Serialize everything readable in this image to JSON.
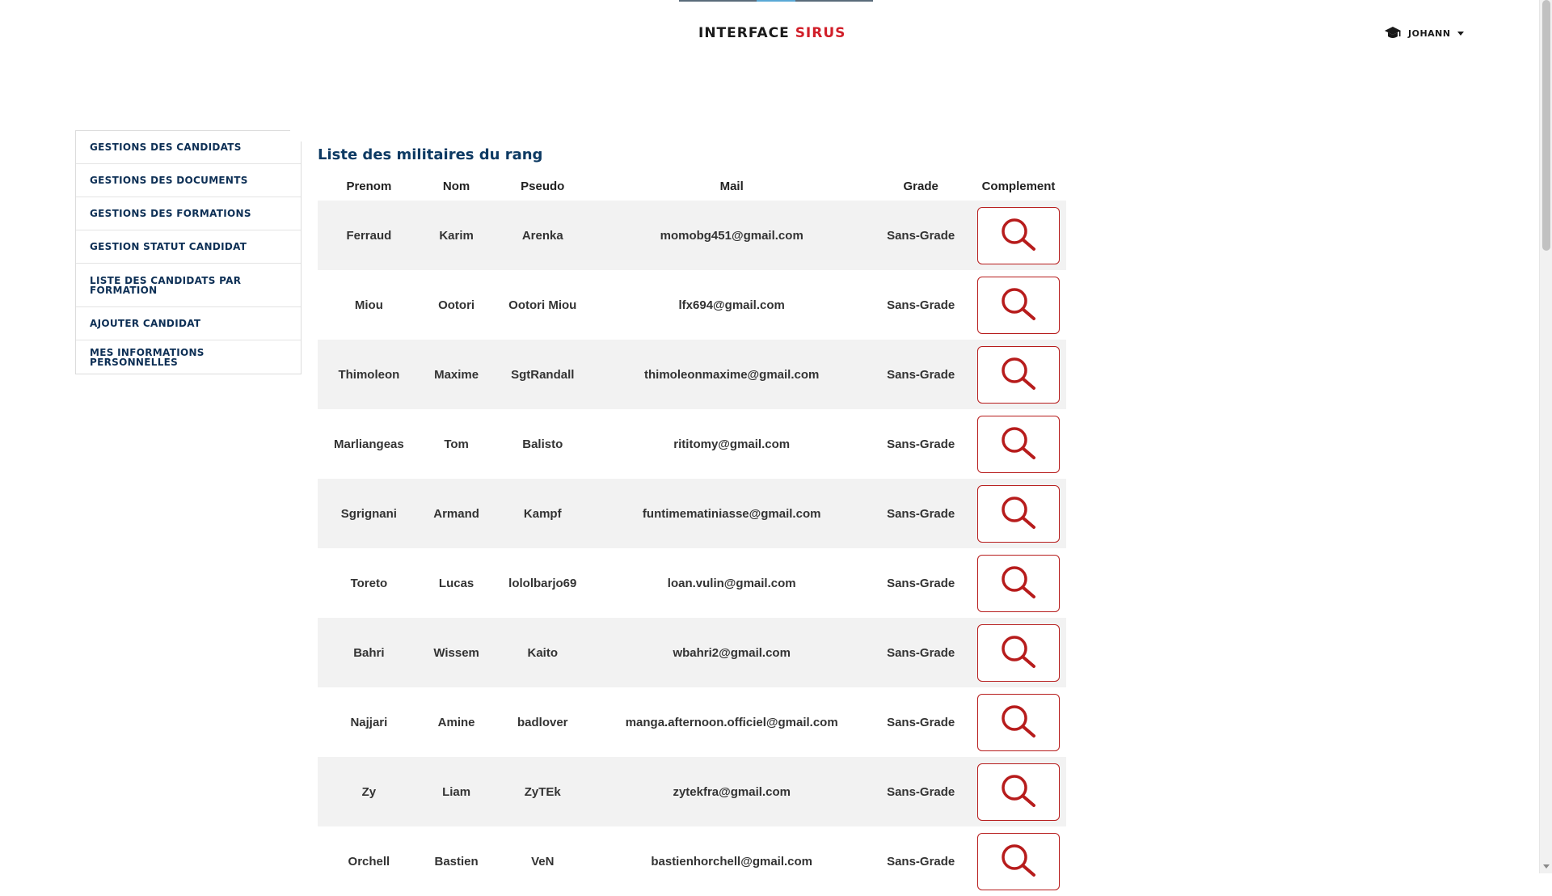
{
  "header": {
    "brand_main": "INTERFACE",
    "brand_accent": "SIRUS",
    "user_name": "JOHANN",
    "user_icon": "graduation-cap-icon"
  },
  "sidebar": {
    "items": [
      {
        "label": "GESTIONS DES CANDIDATS"
      },
      {
        "label": "GESTIONS DES DOCUMENTS"
      },
      {
        "label": "GESTIONS DES FORMATIONS"
      },
      {
        "label": "GESTION STATUT CANDIDAT"
      },
      {
        "label": "LISTE DES CANDIDATS PAR FORMATION"
      },
      {
        "label": "AJOUTER CANDIDAT"
      },
      {
        "label": "MES INFORMATIONS PERSONNELLES"
      }
    ]
  },
  "main": {
    "title": "Liste des militaires du rang",
    "columns": [
      "Prenom",
      "Nom",
      "Pseudo",
      "Mail",
      "Grade",
      "Complement"
    ],
    "rows": [
      {
        "prenom": "Ferraud",
        "nom": "Karim",
        "pseudo": "Arenka",
        "mail": "momobg451@gmail.com",
        "grade": "Sans-Grade"
      },
      {
        "prenom": "Miou",
        "nom": "Ootori",
        "pseudo": "Ootori Miou",
        "mail": "lfx694@gmail.com",
        "grade": "Sans-Grade"
      },
      {
        "prenom": "Thimoleon",
        "nom": "Maxime",
        "pseudo": "SgtRandall",
        "mail": "thimoleonmaxime@gmail.com",
        "grade": "Sans-Grade"
      },
      {
        "prenom": "Marliangeas",
        "nom": "Tom",
        "pseudo": "Balisto",
        "mail": "rititomy@gmail.com",
        "grade": "Sans-Grade"
      },
      {
        "prenom": "Sgrignani",
        "nom": "Armand",
        "pseudo": "Kampf",
        "mail": "funtimematiniasse@gmail.com",
        "grade": "Sans-Grade"
      },
      {
        "prenom": "Toreto",
        "nom": "Lucas",
        "pseudo": "lololbarjo69",
        "mail": "loan.vulin@gmail.com",
        "grade": "Sans-Grade"
      },
      {
        "prenom": "Bahri",
        "nom": "Wissem",
        "pseudo": "Kaito",
        "mail": "wbahri2@gmail.com",
        "grade": "Sans-Grade"
      },
      {
        "prenom": "Najjari",
        "nom": "Amine",
        "pseudo": "badlover",
        "mail": "manga.afternoon.officiel@gmail.com",
        "grade": "Sans-Grade"
      },
      {
        "prenom": "Zy",
        "nom": "Liam",
        "pseudo": "ZyTEk",
        "mail": "zytekfra@gmail.com",
        "grade": "Sans-Grade"
      },
      {
        "prenom": "Orchell",
        "nom": "Bastien",
        "pseudo": "VeN",
        "mail": "bastienhorchell@gmail.com",
        "grade": "Sans-Grade"
      }
    ],
    "action_icon": "search-icon"
  },
  "colors": {
    "brand_accent": "#d11f2a",
    "nav_text": "#0d2f55",
    "title": "#0d3a63",
    "action_border": "#b71c1c",
    "action_icon": "#b71c1c",
    "row_alt": "#f2f2f2"
  }
}
